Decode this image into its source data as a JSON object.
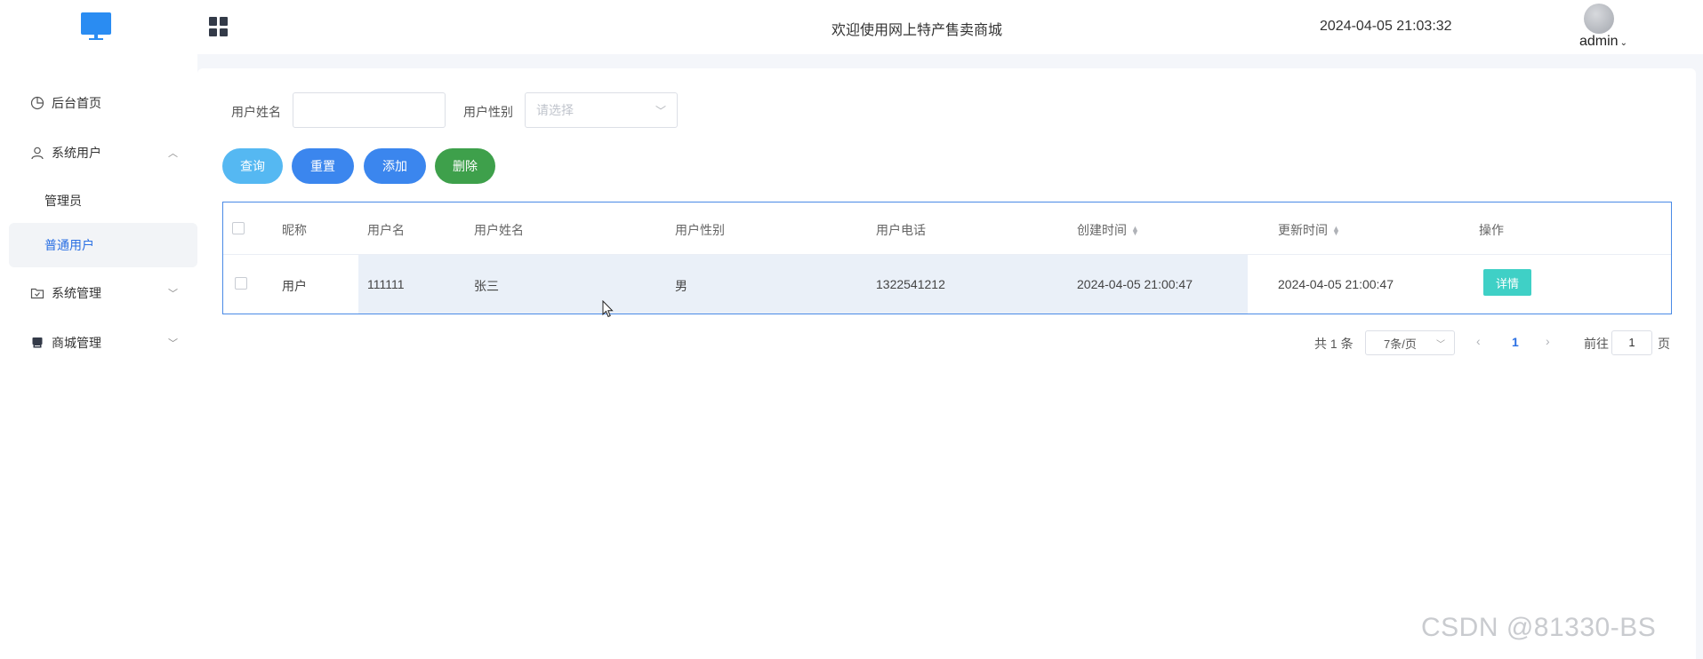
{
  "header": {
    "title": "欢迎使用网上特产售卖商城",
    "datetime": "2024-04-05 21:03:32",
    "user": "admin"
  },
  "sidebar": {
    "items": [
      {
        "label": "后台首页",
        "icon": "pie-chart-icon"
      },
      {
        "label": "系统用户",
        "icon": "user-icon",
        "expanded": true,
        "children": [
          {
            "label": "管理员"
          },
          {
            "label": "普通用户",
            "active": true
          }
        ]
      },
      {
        "label": "系统管理",
        "icon": "folder-check-icon"
      },
      {
        "label": "商城管理",
        "icon": "store-icon"
      }
    ]
  },
  "filters": {
    "name_label": "用户姓名",
    "name_value": "",
    "gender_label": "用户性别",
    "gender_placeholder": "请选择"
  },
  "buttons": {
    "query": "查询",
    "reset": "重置",
    "add": "添加",
    "delete": "删除"
  },
  "colors": {
    "query": "#55b8f2",
    "reset": "#3b86ee",
    "add": "#3b86ee",
    "delete": "#3ea04b",
    "detail": "#3fd0c6",
    "accent": "#2a6fe3"
  },
  "table": {
    "headers": [
      "昵称",
      "用户名",
      "用户姓名",
      "用户性别",
      "用户电话",
      "创建时间",
      "更新时间",
      "操作"
    ],
    "rows": [
      {
        "nickname": "用户",
        "username": "111111",
        "realname": "张三",
        "gender": "男",
        "phone": "1322541212",
        "created": "2024-04-05 21:00:47",
        "updated": "2024-04-05 21:00:47",
        "action": "详情"
      }
    ]
  },
  "pagination": {
    "total": "共 1 条",
    "page_size": "7条/页",
    "current": "1",
    "goto_prefix": "前往",
    "goto_value": "1",
    "goto_suffix": "页"
  },
  "watermark": "CSDN @81330-BS"
}
